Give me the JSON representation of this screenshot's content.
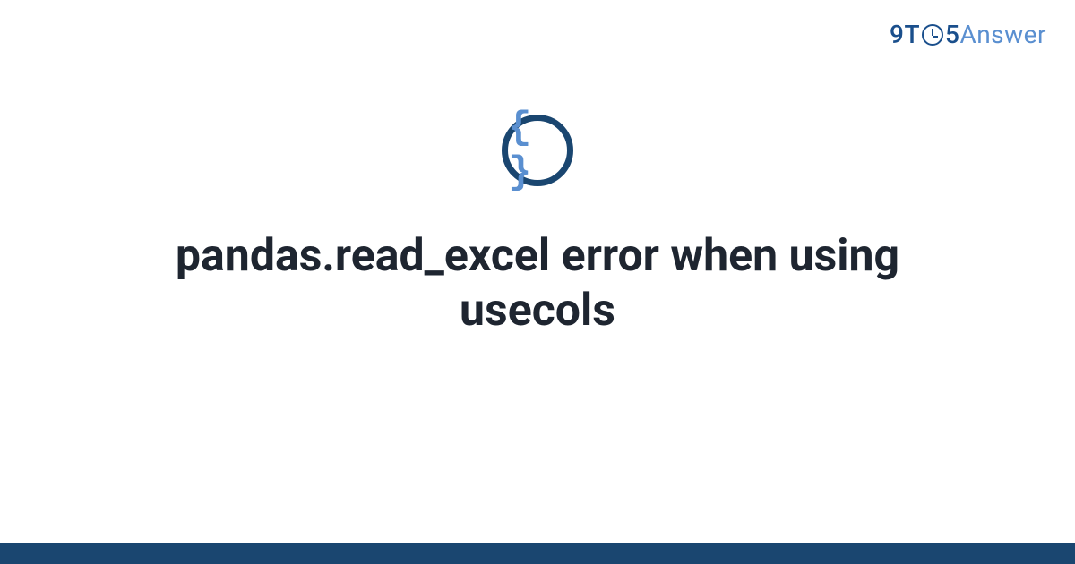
{
  "brand": {
    "part1": "9T",
    "part2": "5",
    "part3": "Answer"
  },
  "icon": {
    "braces": "{ }"
  },
  "title": "pandas.read_excel error when using usecols",
  "colors": {
    "darkBlue": "#1a4670",
    "brandBlue": "#1a4f8c",
    "lightBlue": "#5a8fd0",
    "text": "#1e2530"
  }
}
